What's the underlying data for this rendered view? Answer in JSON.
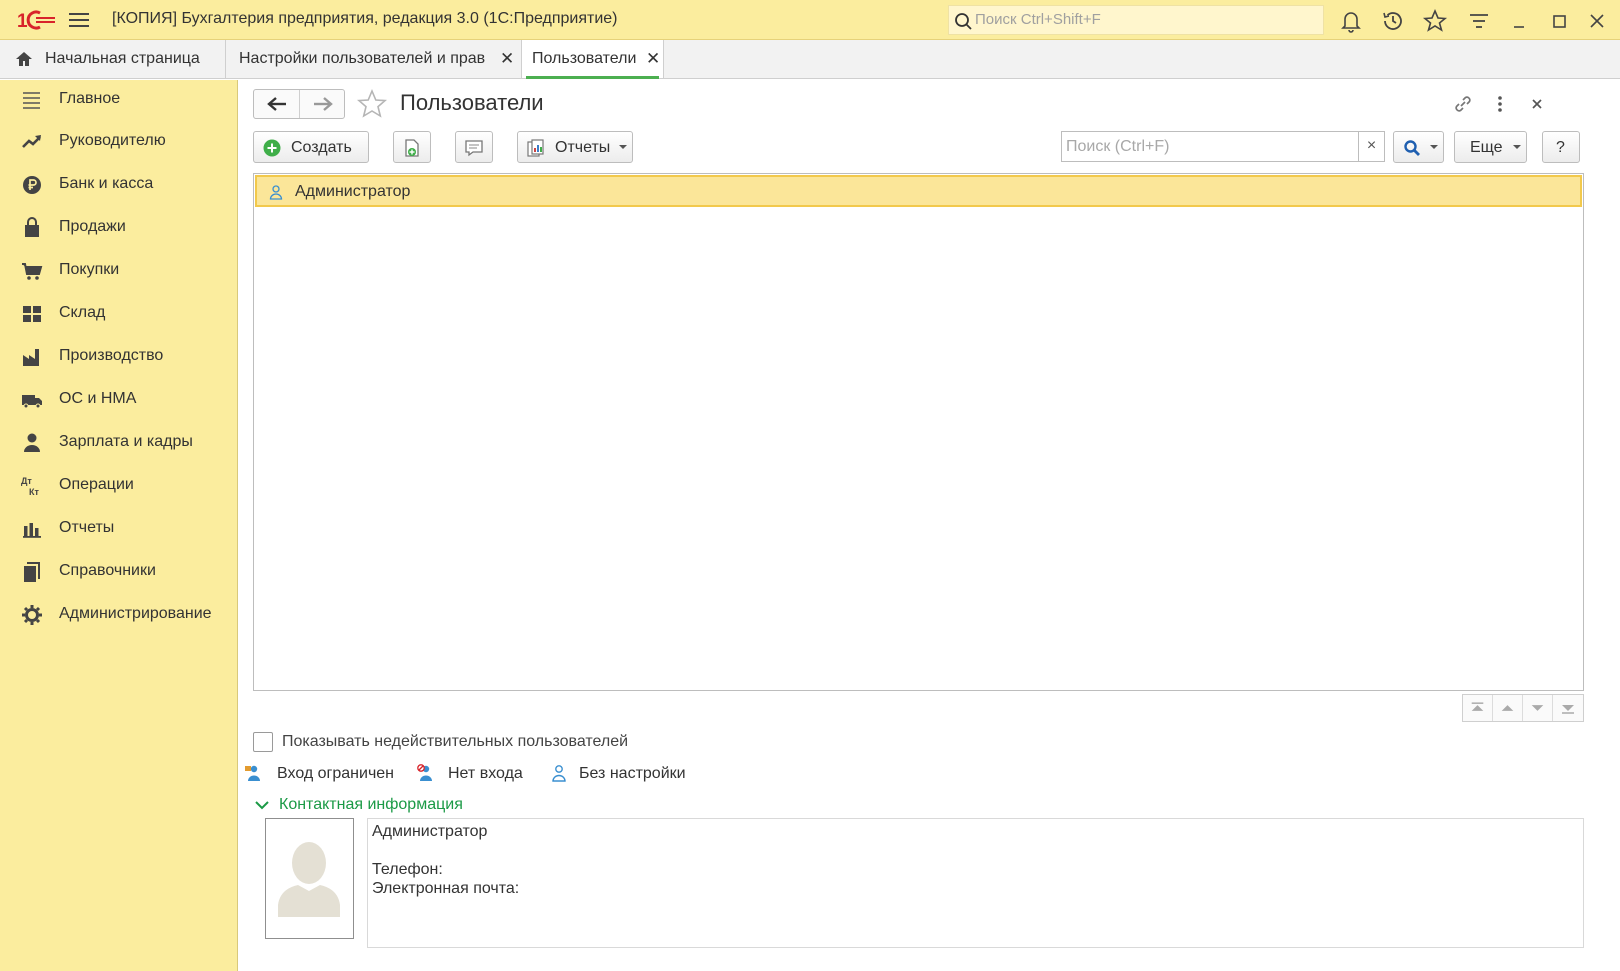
{
  "window": {
    "title": "[КОПИЯ] Бухгалтерия предприятия, редакция 3.0  (1С:Предприятие)",
    "search_placeholder": "Поиск Ctrl+Shift+F"
  },
  "tabs": [
    {
      "label": "Начальная страница"
    },
    {
      "label": "Настройки пользователей и прав"
    },
    {
      "label": "Пользователи"
    }
  ],
  "sidebar": {
    "items": [
      {
        "label": "Главное",
        "icon": "menu-lines-icon"
      },
      {
        "label": "Руководителю",
        "icon": "trend-icon"
      },
      {
        "label": "Банк и касса",
        "icon": "ruble-icon"
      },
      {
        "label": "Продажи",
        "icon": "shopping-bag-icon"
      },
      {
        "label": "Покупки",
        "icon": "cart-icon"
      },
      {
        "label": "Склад",
        "icon": "warehouse-icon"
      },
      {
        "label": "Производство",
        "icon": "factory-icon"
      },
      {
        "label": "ОС и НМА",
        "icon": "truck-icon"
      },
      {
        "label": "Зарплата и кадры",
        "icon": "person-icon"
      },
      {
        "label": "Операции",
        "icon": "dt-kt-icon"
      },
      {
        "label": "Отчеты",
        "icon": "bar-chart-icon"
      },
      {
        "label": "Справочники",
        "icon": "books-icon"
      },
      {
        "label": "Администрирование",
        "icon": "gear-icon"
      }
    ]
  },
  "form": {
    "title": "Пользователи",
    "create_label": "Создать",
    "reports_label": "Отчеты",
    "search_placeholder": "Поиск (Ctrl+F)",
    "more_label": "Еще",
    "help_label": "?",
    "clear_label": "×"
  },
  "users": [
    {
      "name": "Администратор"
    }
  ],
  "show_invalid_label": "Показывать недействительных пользователей",
  "legend": {
    "restricted": "Вход ограничен",
    "no_login": "Нет входа",
    "no_setup": "Без настройки"
  },
  "contact": {
    "group_label": "Контактная информация",
    "name": "Администратор",
    "phone_label": "Телефон:",
    "email_label": "Электронная почта:"
  },
  "colors": {
    "accent_green": "#4caf50",
    "sidebar_bg": "#fbed9e",
    "selected_row": "#fbe699"
  }
}
